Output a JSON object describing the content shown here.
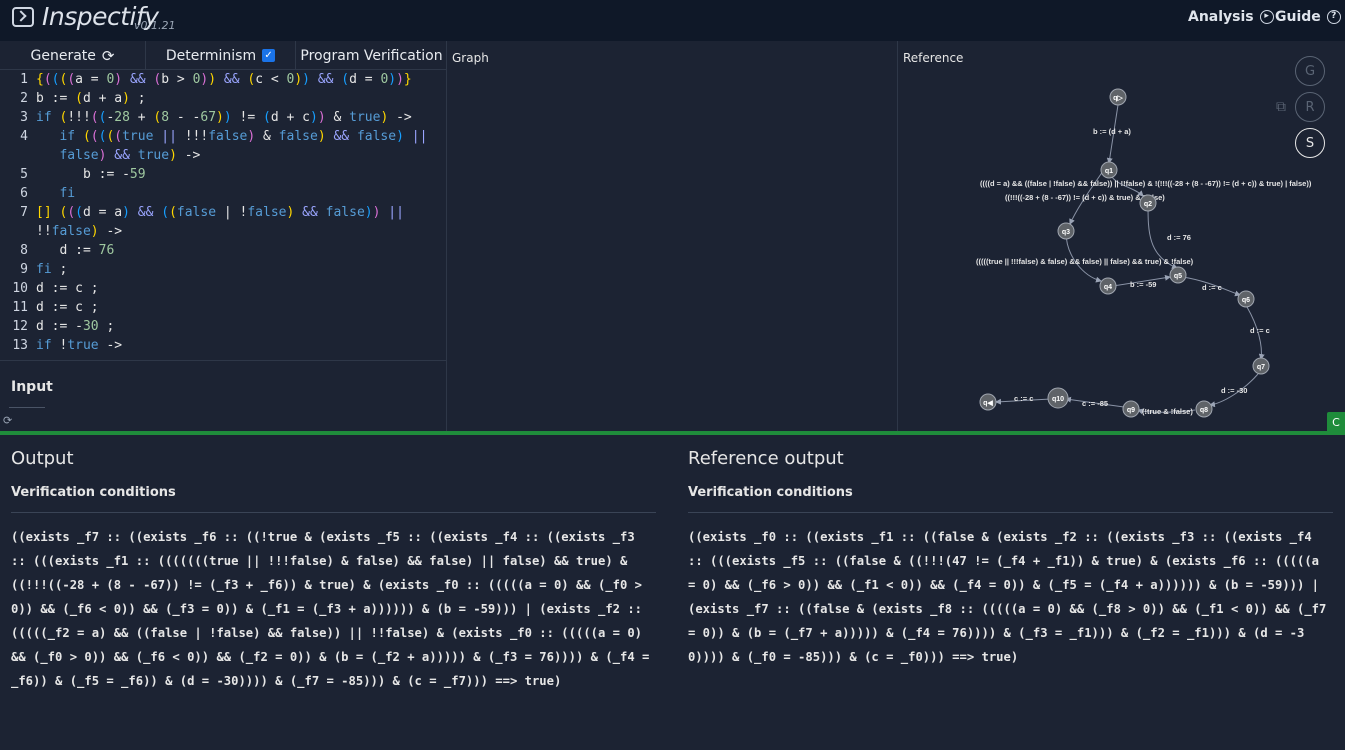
{
  "header": {
    "title": "Inspectify",
    "version": "v0.1.21",
    "nav": [
      {
        "label": "Analysis"
      },
      {
        "label": "Guide"
      }
    ]
  },
  "editor": {
    "tabs": {
      "generate": "Generate",
      "determinism": "Determinism",
      "program_verification": "Program Verification"
    },
    "lines": [
      {
        "n": "1",
        "html": "<span class='p1'>{</span><span class='p2'>(</span><span class='p3'>(</span><span class='p1'>(</span><span class='p2'>(</span>a = <span class='num'>0</span><span class='p2'>)</span> <span class='op'>&amp;&amp;</span> <span class='p2'>(</span>b &gt; <span class='num'>0</span><span class='p2'>)</span><span class='p1'>)</span> <span class='op'>&amp;&amp;</span> <span class='p1'>(</span>c &lt; <span class='num'>0</span><span class='p1'>)</span><span class='p3'>)</span> <span class='op'>&amp;&amp;</span> <span class='p3'>(</span>d = <span class='num'>0</span><span class='p3'>)</span><span class='p2'>)</span><span class='p1'>}</span>"
      },
      {
        "n": "2",
        "html": "b := <span class='p1'>(</span>d + a<span class='p1'>)</span> ;"
      },
      {
        "n": "3",
        "html": "<span class='kw'>if</span> <span class='p1'>(</span>!!!<span class='p2'>(</span><span class='p3'>(</span>-<span class='num'>28</span> + <span class='p1'>(</span><span class='num'>8</span> - -<span class='num'>67</span><span class='p1'>)</span><span class='p3'>)</span> != <span class='p3'>(</span>d + c<span class='p3'>)</span><span class='p2'>)</span> &amp; <span class='kw'>true</span><span class='p1'>)</span> -&gt;"
      },
      {
        "n": "4",
        "html": "   <span class='kw'>if</span> <span class='p1'>(</span><span class='p2'>(</span><span class='p3'>(</span><span class='p1'>(</span><span class='p2'>(</span><span class='kw'>true</span> <span class='op'>||</span> !!!<span class='kw'>false</span><span class='p2'>)</span> &amp; <span class='kw'>false</span><span class='p1'>)</span> <span class='op'>&amp;&amp;</span> <span class='kw'>false</span><span class='p3'>)</span> <span class='op'>||</span>"
      },
      {
        "n": "",
        "html": "   <span class='kw'>false</span><span class='p2'>)</span> <span class='op'>&amp;&amp;</span> <span class='kw'>true</span><span class='p1'>)</span> -&gt;"
      },
      {
        "n": "5",
        "html": "      b := -<span class='num'>59</span>"
      },
      {
        "n": "6",
        "html": "   <span class='kw'>fi</span>"
      },
      {
        "n": "7",
        "html": "<span class='p1'>[]</span> <span class='p1'>(</span><span class='p2'>(</span><span class='p3'>(</span>d = a<span class='p3'>)</span> <span class='op'>&amp;&amp;</span> <span class='p3'>(</span><span class='p1'>(</span><span class='kw'>false</span> | !<span class='kw'>false</span><span class='p1'>)</span> <span class='op'>&amp;&amp;</span> <span class='kw'>false</span><span class='p3'>)</span><span class='p2'>)</span> <span class='op'>||</span>"
      },
      {
        "n": "",
        "html": "!!<span class='kw'>false</span><span class='p1'>)</span> -&gt;"
      },
      {
        "n": "8",
        "html": "   d := <span class='num'>76</span>"
      },
      {
        "n": "9",
        "html": "<span class='kw'>fi</span> ;"
      },
      {
        "n": "10",
        "html": "d := c ;"
      },
      {
        "n": "11",
        "html": "d := c ;"
      },
      {
        "n": "12",
        "html": "d := -<span class='num'>30</span> ;"
      },
      {
        "n": "13",
        "html": "<span class='kw'>if</span> !<span class='kw'>true</span> -&gt;"
      }
    ]
  },
  "input": {
    "label": "Input"
  },
  "graph": {
    "label": "Graph"
  },
  "reference": {
    "label": "Reference",
    "buttons": {
      "g": "G",
      "r": "R",
      "s": "S",
      "c": "C"
    },
    "nodes": [
      "q▷",
      "q1",
      "q2",
      "q3",
      "q4",
      "q5",
      "q6",
      "q7",
      "q8",
      "q9",
      "q10",
      "q◀"
    ],
    "edges": [
      "b := (d + a)",
      "((((d = a) && ((false | !false) && false)) || !!false) & !(!!!((-28 + (8 - -67)) != (d + c)) & true) | false))",
      "((!!!((-28 + (8 - -67)) != (d + c)) & true) & !false)",
      "d := 76",
      "(((((true || !!!false) & false) && false) || false) && true) & !false)",
      "b := -59",
      "d := c",
      "d := c",
      "d := -30",
      "(!true & !false)",
      "c := -85",
      "c := c"
    ]
  },
  "output": {
    "title": "Output",
    "vc_label": "Verification conditions",
    "vc": "((exists _f7 :: ((exists _f6 :: ((!true & (exists _f5 :: ((exists _f4 :: ((exists _f3 :: (((exists _f1 :: (((((((true || !!!false) & false) && false) || false) && true) & ((!!!((-28 + (8 - -67)) != (_f3 + _f6)) & true) & (exists _f0 :: (((((a = 0) && (_f0 > 0)) && (_f6 < 0)) && (_f3 = 0)) & (_f1 = (_f3 + a)))))) & (b = -59))) | (exists _f2 :: (((((_f2 = a) && ((false | !false) && false)) || !!false) & (exists _f0 :: (((((a = 0) && (_f0 > 0)) && (_f6 < 0)) && (_f2 = 0)) & (b = (_f2 + a))))) & (_f3 = 76)))) & (_f4 = _f6)) & (_f5 = _f6)) & (d = -30)))) & (_f7 = -85))) & (c = _f7))) ==> true)"
  },
  "ref_output": {
    "title": "Reference output",
    "vc_label": "Verification conditions",
    "vc": "((exists _f0 :: ((exists _f1 :: ((false & (exists _f2 :: ((exists _f3 :: ((exists _f4 :: (((exists _f5 :: ((false & ((!!!(47 != (_f4 + _f1)) & true) & (exists _f6 :: (((((a = 0) && (_f6 > 0)) && (_f1 < 0)) && (_f4 = 0)) & (_f5 = (_f4 + a)))))) & (b = -59))) | (exists _f7 :: ((false & (exists _f8 :: (((((a = 0) && (_f8 > 0)) && (_f1 < 0)) && (_f7 = 0)) & (b = (_f7 + a))))) & (_f4 = 76)))) & (_f3 = _f1))) & (_f2 = _f1))) & (d = -30)))) & (_f0 = -85))) & (c = _f0))) ==> true)"
  }
}
